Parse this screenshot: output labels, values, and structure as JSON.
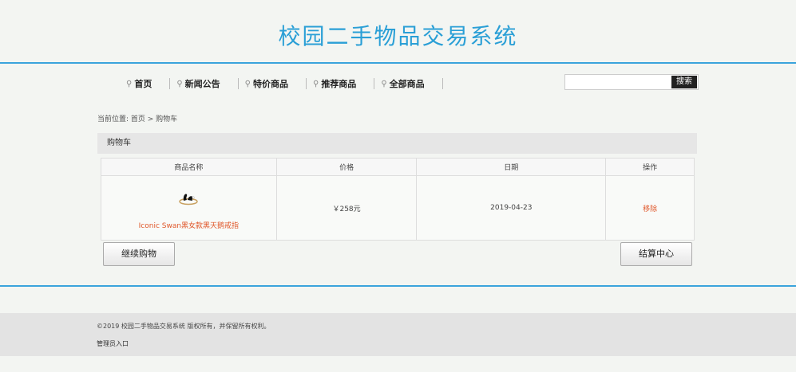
{
  "site": {
    "title": "校园二手物品交易系统"
  },
  "nav": {
    "items": [
      {
        "label": "首页"
      },
      {
        "label": "新闻公告"
      },
      {
        "label": "特价商品"
      },
      {
        "label": "推荐商品"
      },
      {
        "label": "全部商品"
      }
    ]
  },
  "search": {
    "value": "",
    "placeholder": "",
    "button": "搜索"
  },
  "breadcrumb": "当前位置: 首页 > 购物车",
  "cart": {
    "heading": "购物车",
    "columns": [
      "商品名称",
      "价格",
      "日期",
      "操作"
    ],
    "rows": [
      {
        "name": "Iconic Swan黑女款黑天鹅戒指",
        "price": "￥258元",
        "date": "2019-04-23",
        "action": "移除"
      }
    ]
  },
  "buttons": {
    "continue": "继续购物",
    "checkout": "结算中心"
  },
  "footer": {
    "copyright": "©2019 校园二手物品交易系统 版权所有，并保留所有权利。",
    "admin_link": "管理员入口"
  },
  "colors": {
    "accent": "#3aa3dc",
    "link": "#e0572a"
  }
}
